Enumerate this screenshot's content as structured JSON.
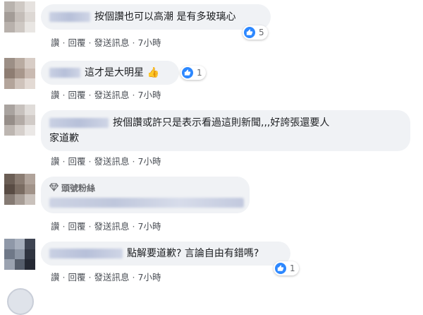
{
  "actions": {
    "like": "讚",
    "reply": "回覆",
    "message": "發送訊息",
    "time": "7小時",
    "separator": "·"
  },
  "comments": [
    {
      "text": "按個讚也可以高潮 是有多玻璃心",
      "reaction_count": "5"
    },
    {
      "text": "這才是大明星",
      "emoji": "👍",
      "reaction_count": "1"
    },
    {
      "text": "按個讚或許只是表示看過這則新聞,,,好誇張還要人",
      "text_line2": "家道歉"
    },
    {
      "badge": "頭號粉絲"
    },
    {
      "text": "點解要道歉? 言論自由有錯嗎?",
      "reaction_count": "1"
    }
  ],
  "colors": {
    "bubble": "#f0f2f5",
    "like_blue": "#2d88ff",
    "action_text": "#4b4f56"
  },
  "icons": {
    "like": "thumbs-up-icon",
    "badge": "diamond-icon"
  }
}
